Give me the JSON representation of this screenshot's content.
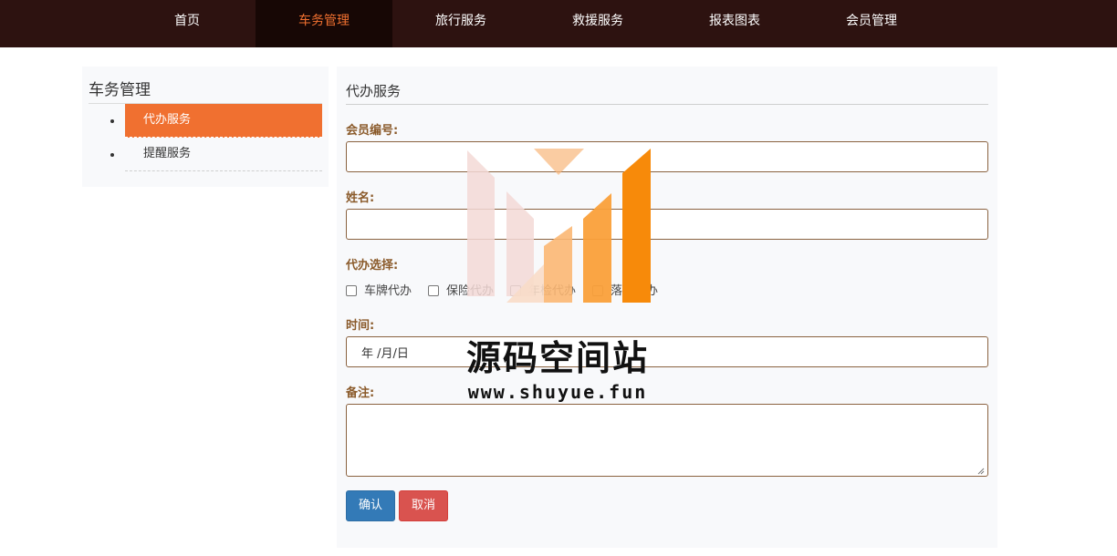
{
  "topnav": {
    "items": [
      {
        "label": "首页",
        "active": false
      },
      {
        "label": "车务管理",
        "active": true
      },
      {
        "label": "旅行服务",
        "active": false
      },
      {
        "label": "救援服务",
        "active": false
      },
      {
        "label": "报表图表",
        "active": false
      },
      {
        "label": "会员管理",
        "active": false
      }
    ]
  },
  "sidebar": {
    "title": "车务管理",
    "items": [
      {
        "label": "代办服务",
        "active": true
      },
      {
        "label": "提醒服务",
        "active": false
      }
    ]
  },
  "main": {
    "title": "代办服务",
    "member_id_label": "会员编号:",
    "member_id_value": "",
    "name_label": "姓名:",
    "name_value": "",
    "options_label": "代办选择:",
    "options": [
      {
        "label": "车牌代办",
        "checked": false
      },
      {
        "label": "保险代办",
        "checked": false
      },
      {
        "label": "年检代办",
        "checked": false
      },
      {
        "label": "落户代办",
        "checked": false
      }
    ],
    "time_label": "时间:",
    "time_value": "年 /月/日",
    "remark_label": "备注:",
    "remark_value": "",
    "confirm_label": "确认",
    "cancel_label": "取消"
  },
  "watermark": {
    "title": "源码空间站",
    "url": "www.shuyue.fun"
  },
  "colors": {
    "nav_bg": "#2d1210",
    "nav_active_bg": "#170705",
    "accent": "#f07030",
    "label_brown": "#8a5a2a",
    "confirm_blue": "#337ab7",
    "cancel_red": "#d9534f"
  }
}
